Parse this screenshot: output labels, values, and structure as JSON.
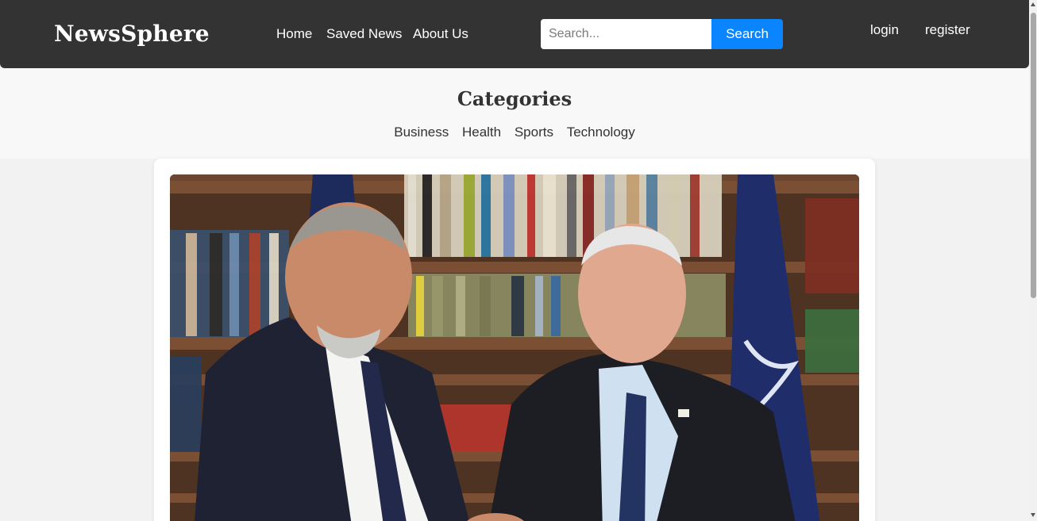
{
  "header": {
    "brand": "NewsSphere",
    "nav": [
      {
        "label": "Home"
      },
      {
        "label": "Saved News"
      },
      {
        "label": "About Us"
      }
    ],
    "search": {
      "placeholder": "Search...",
      "value": "",
      "button_label": "Search"
    },
    "auth": {
      "login_label": "login",
      "register_label": "register"
    }
  },
  "categories": {
    "title": "Categories",
    "items": [
      {
        "label": "Business"
      },
      {
        "label": "Health"
      },
      {
        "label": "Sports"
      },
      {
        "label": "Technology"
      }
    ]
  },
  "article": {
    "image": {
      "icon": "news-photo"
    }
  },
  "colors": {
    "navbar": "#333333",
    "accent": "#0a84ff",
    "page_background": "#f2f2f2"
  }
}
